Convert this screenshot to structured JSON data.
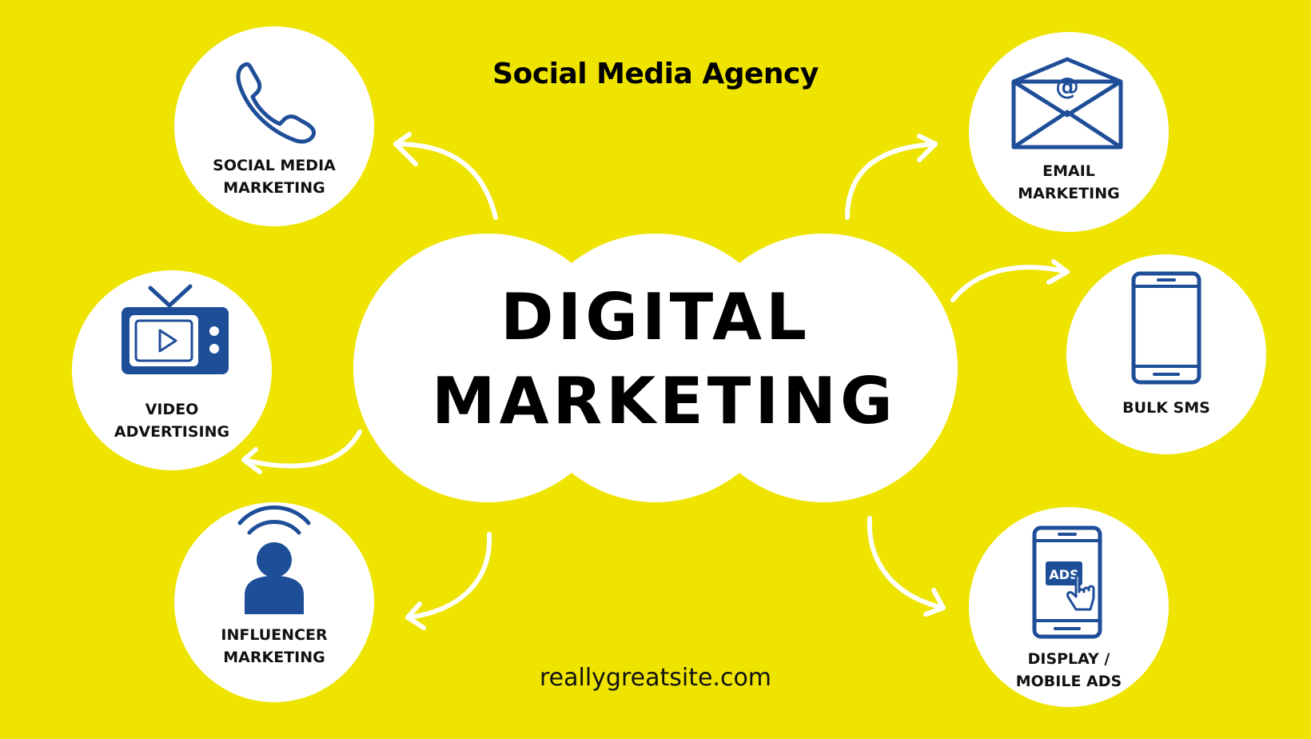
{
  "header": {
    "agency": "Social Media Agency"
  },
  "center": {
    "line1": "DIGITAL",
    "line2": "MARKETING"
  },
  "footer": {
    "website": "reallygreatsite.com"
  },
  "services": {
    "social": {
      "line1": "SOCIAL MEDIA",
      "line2": "MARKETING",
      "icon": "phone-icon"
    },
    "video": {
      "line1": "VIDEO",
      "line2": "ADVERTISING",
      "icon": "tv-play-icon"
    },
    "influencer": {
      "line1": "INFLUENCER",
      "line2": "MARKETING",
      "icon": "person-broadcast-icon"
    },
    "email": {
      "line1": "EMAIL",
      "line2": "MARKETING",
      "icon": "envelope-at-icon"
    },
    "sms": {
      "line1": "BULK SMS",
      "icon": "mobile-phone-icon"
    },
    "ads": {
      "line1": "DISPLAY /",
      "line2": "MOBILE ADS",
      "icon": "phone-ads-icon"
    }
  },
  "colors": {
    "background": "#EEE400",
    "icon_blue": "#1F4E99",
    "text": "#111111"
  }
}
